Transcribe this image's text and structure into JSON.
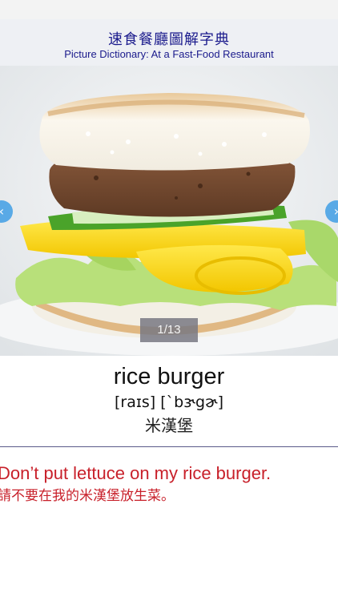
{
  "header": {
    "title_zh": "速食餐廳圖解字典",
    "title_en": "Picture Dictionary: At a Fast-Food Restaurant"
  },
  "viewer": {
    "page_counter": "1/13",
    "prev_icon": "chevron-left-icon",
    "next_icon": "chevron-right-icon"
  },
  "entry": {
    "word": "rice burger",
    "pronunciation": "[raɪs] [ˋbɝgɚ]",
    "translation": "米漢堡"
  },
  "example": {
    "sentence_en": "Don’t put lettuce on my rice burger.",
    "sentence_zh": "請不要在我的米漢堡放生菜。"
  },
  "colors": {
    "header_text": "#1a1a8c",
    "example_text": "#c8202a",
    "nav_arrow": "#4aa3e6"
  }
}
